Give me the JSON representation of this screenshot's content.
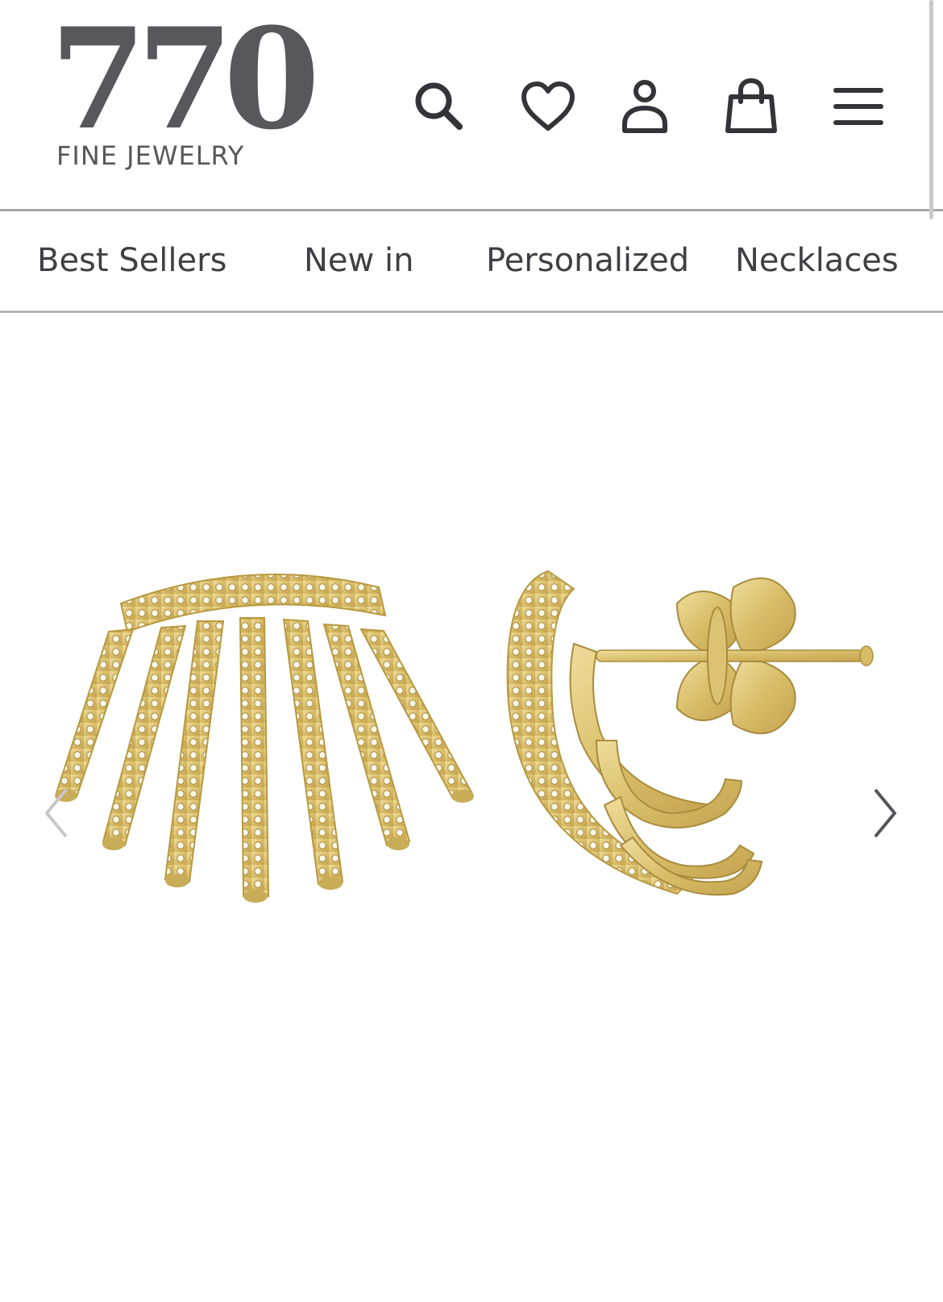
{
  "header": {
    "logo_number": "770",
    "logo_sub": "FINE JEWELRY",
    "icons": [
      "search-icon",
      "heart-icon",
      "account-icon",
      "cart-icon",
      "menu-icon"
    ]
  },
  "nav": {
    "items": [
      {
        "label": "Best Sellers"
      },
      {
        "label": "New in"
      },
      {
        "label": "Personalized"
      },
      {
        "label": "Necklaces"
      }
    ]
  },
  "gallery": {
    "prev_icon": "chevron-left-icon",
    "next_icon": "chevron-right-icon",
    "image_alt": "Gold diamond multi-row huggie earrings"
  },
  "colors": {
    "text": "#3f3f44",
    "logo": "#57575c",
    "divider": "#a7a7aa",
    "gold": "#d9bf6e"
  }
}
